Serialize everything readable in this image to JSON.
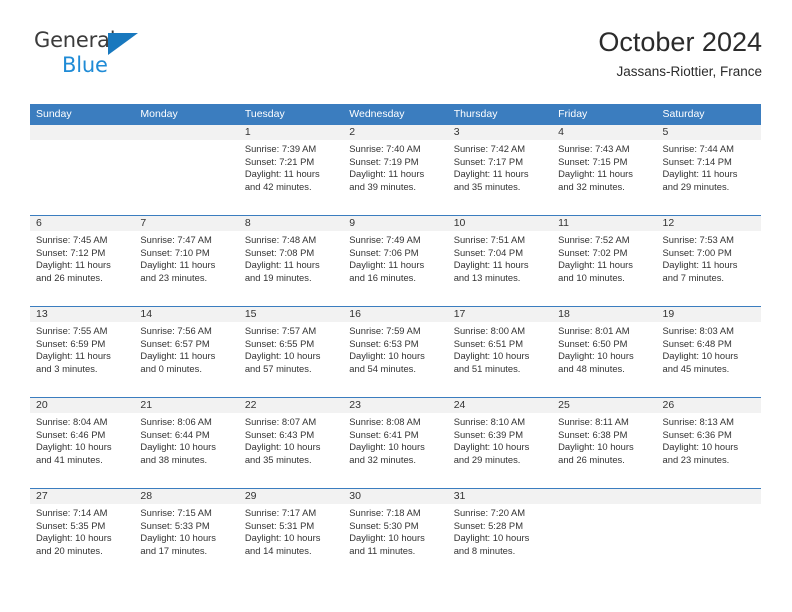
{
  "brand": {
    "name_top": "General",
    "name_bottom": "Blue",
    "triangle_icon": "brand-triangle-icon",
    "color_dark": "#3b3b3b",
    "color_blue": "#1f8bd6",
    "triangle_color": "#1878be"
  },
  "header": {
    "title": "October 2024",
    "subtitle": "Jassans-Riottier, France"
  },
  "theme": {
    "header_blue": "#3b7dbf",
    "band_gray": "#f2f2f2",
    "text": "#333333"
  },
  "weekday_headers": [
    "Sunday",
    "Monday",
    "Tuesday",
    "Wednesday",
    "Thursday",
    "Friday",
    "Saturday"
  ],
  "weeks": [
    [
      {
        "day": "",
        "details": ""
      },
      {
        "day": "",
        "details": ""
      },
      {
        "day": "1",
        "details": "Sunrise: 7:39 AM\nSunset: 7:21 PM\nDaylight: 11 hours\nand 42 minutes."
      },
      {
        "day": "2",
        "details": "Sunrise: 7:40 AM\nSunset: 7:19 PM\nDaylight: 11 hours\nand 39 minutes."
      },
      {
        "day": "3",
        "details": "Sunrise: 7:42 AM\nSunset: 7:17 PM\nDaylight: 11 hours\nand 35 minutes."
      },
      {
        "day": "4",
        "details": "Sunrise: 7:43 AM\nSunset: 7:15 PM\nDaylight: 11 hours\nand 32 minutes."
      },
      {
        "day": "5",
        "details": "Sunrise: 7:44 AM\nSunset: 7:14 PM\nDaylight: 11 hours\nand 29 minutes."
      }
    ],
    [
      {
        "day": "6",
        "details": "Sunrise: 7:45 AM\nSunset: 7:12 PM\nDaylight: 11 hours\nand 26 minutes."
      },
      {
        "day": "7",
        "details": "Sunrise: 7:47 AM\nSunset: 7:10 PM\nDaylight: 11 hours\nand 23 minutes."
      },
      {
        "day": "8",
        "details": "Sunrise: 7:48 AM\nSunset: 7:08 PM\nDaylight: 11 hours\nand 19 minutes."
      },
      {
        "day": "9",
        "details": "Sunrise: 7:49 AM\nSunset: 7:06 PM\nDaylight: 11 hours\nand 16 minutes."
      },
      {
        "day": "10",
        "details": "Sunrise: 7:51 AM\nSunset: 7:04 PM\nDaylight: 11 hours\nand 13 minutes."
      },
      {
        "day": "11",
        "details": "Sunrise: 7:52 AM\nSunset: 7:02 PM\nDaylight: 11 hours\nand 10 minutes."
      },
      {
        "day": "12",
        "details": "Sunrise: 7:53 AM\nSunset: 7:00 PM\nDaylight: 11 hours\nand 7 minutes."
      }
    ],
    [
      {
        "day": "13",
        "details": "Sunrise: 7:55 AM\nSunset: 6:59 PM\nDaylight: 11 hours\nand 3 minutes."
      },
      {
        "day": "14",
        "details": "Sunrise: 7:56 AM\nSunset: 6:57 PM\nDaylight: 11 hours\nand 0 minutes."
      },
      {
        "day": "15",
        "details": "Sunrise: 7:57 AM\nSunset: 6:55 PM\nDaylight: 10 hours\nand 57 minutes."
      },
      {
        "day": "16",
        "details": "Sunrise: 7:59 AM\nSunset: 6:53 PM\nDaylight: 10 hours\nand 54 minutes."
      },
      {
        "day": "17",
        "details": "Sunrise: 8:00 AM\nSunset: 6:51 PM\nDaylight: 10 hours\nand 51 minutes."
      },
      {
        "day": "18",
        "details": "Sunrise: 8:01 AM\nSunset: 6:50 PM\nDaylight: 10 hours\nand 48 minutes."
      },
      {
        "day": "19",
        "details": "Sunrise: 8:03 AM\nSunset: 6:48 PM\nDaylight: 10 hours\nand 45 minutes."
      }
    ],
    [
      {
        "day": "20",
        "details": "Sunrise: 8:04 AM\nSunset: 6:46 PM\nDaylight: 10 hours\nand 41 minutes."
      },
      {
        "day": "21",
        "details": "Sunrise: 8:06 AM\nSunset: 6:44 PM\nDaylight: 10 hours\nand 38 minutes."
      },
      {
        "day": "22",
        "details": "Sunrise: 8:07 AM\nSunset: 6:43 PM\nDaylight: 10 hours\nand 35 minutes."
      },
      {
        "day": "23",
        "details": "Sunrise: 8:08 AM\nSunset: 6:41 PM\nDaylight: 10 hours\nand 32 minutes."
      },
      {
        "day": "24",
        "details": "Sunrise: 8:10 AM\nSunset: 6:39 PM\nDaylight: 10 hours\nand 29 minutes."
      },
      {
        "day": "25",
        "details": "Sunrise: 8:11 AM\nSunset: 6:38 PM\nDaylight: 10 hours\nand 26 minutes."
      },
      {
        "day": "26",
        "details": "Sunrise: 8:13 AM\nSunset: 6:36 PM\nDaylight: 10 hours\nand 23 minutes."
      }
    ],
    [
      {
        "day": "27",
        "details": "Sunrise: 7:14 AM\nSunset: 5:35 PM\nDaylight: 10 hours\nand 20 minutes."
      },
      {
        "day": "28",
        "details": "Sunrise: 7:15 AM\nSunset: 5:33 PM\nDaylight: 10 hours\nand 17 minutes."
      },
      {
        "day": "29",
        "details": "Sunrise: 7:17 AM\nSunset: 5:31 PM\nDaylight: 10 hours\nand 14 minutes."
      },
      {
        "day": "30",
        "details": "Sunrise: 7:18 AM\nSunset: 5:30 PM\nDaylight: 10 hours\nand 11 minutes."
      },
      {
        "day": "31",
        "details": "Sunrise: 7:20 AM\nSunset: 5:28 PM\nDaylight: 10 hours\nand 8 minutes."
      },
      {
        "day": "",
        "details": ""
      },
      {
        "day": "",
        "details": ""
      }
    ]
  ]
}
